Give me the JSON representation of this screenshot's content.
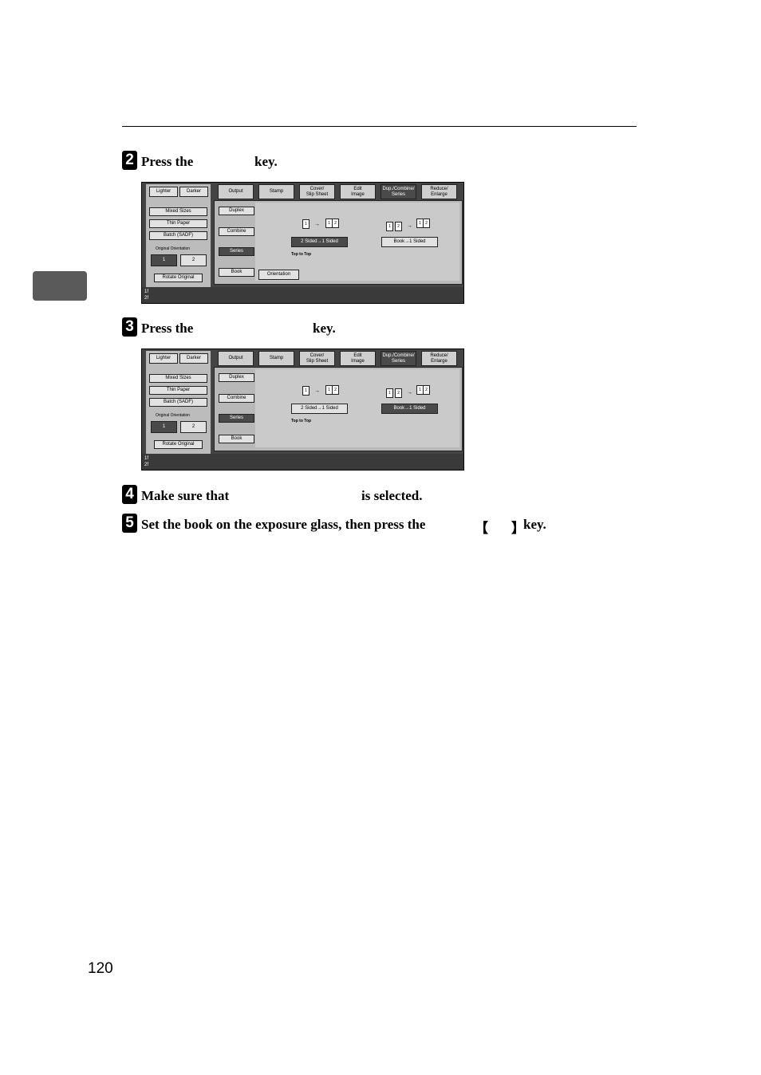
{
  "page": {
    "number": "120"
  },
  "steps": [
    {
      "num": "2",
      "prefix": "Press the",
      "suffix": "key."
    },
    {
      "num": "3",
      "prefix": "Press the",
      "suffix": "key."
    },
    {
      "num": "4",
      "prefix": "Make sure that",
      "suffix": "is selected."
    },
    {
      "num": "5",
      "prefix": "Set the book on the exposure glass, then press the",
      "bracket_open": "【",
      "bracket_close": "】",
      "suffix": "key."
    }
  ],
  "panel": {
    "lighter": "Lighter",
    "darker": "Darker",
    "mixed_sizes": "Mixed Sizes",
    "thin_paper": "Thin Paper",
    "batch": "Batch (SADF)",
    "original_orientation": "Original Orientation",
    "rotate_original": "Rotate Original",
    "tabs": {
      "output": "Output",
      "stamp": "Stamp",
      "cover_1": "Cover/",
      "cover_2": "Slip Sheet",
      "edit_1": "Edit",
      "edit_2": "Image",
      "dup_1": "Dup./Combine/",
      "dup_2": "Series",
      "reduce_1": "Reduce/",
      "reduce_2": "Enlarge"
    },
    "duplex": "Duplex",
    "combine": "Combine",
    "series": "Series",
    "book": "Book",
    "opt_2sided": "2 Sided→1 Sided",
    "opt_book": "Book→1 Sided",
    "top_to_top": "Top to Top",
    "orientation": "Orientation",
    "page_1": "1",
    "page_2": "2",
    "arrow": "→",
    "status_1": "1f",
    "status_2": "2f"
  }
}
